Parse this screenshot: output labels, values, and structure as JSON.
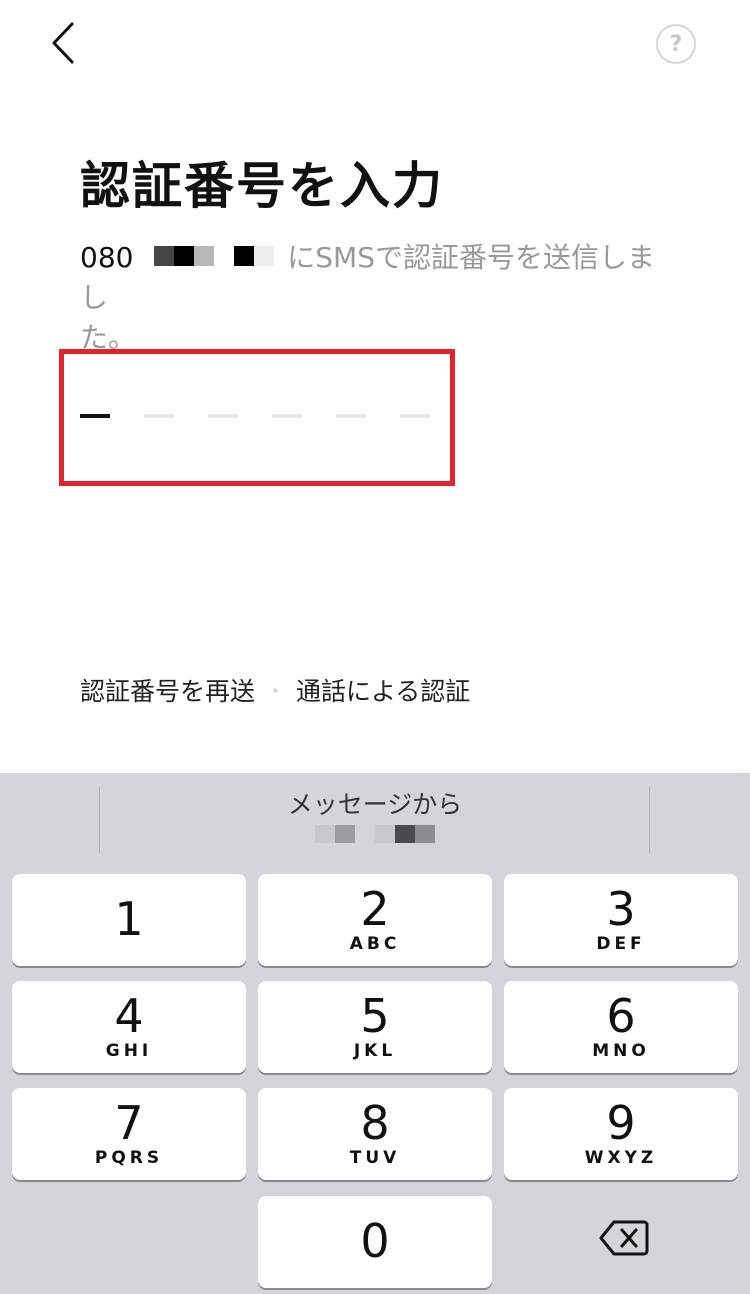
{
  "nav": {
    "back_icon": "chevron-left-icon",
    "help_label": "?"
  },
  "title": "認証番号を入力",
  "subtitle": {
    "phone_prefix": "080",
    "text_line": "にSMSで認証番号を送信しまし",
    "text_line2": "た。"
  },
  "code_input": {
    "length": 6,
    "filled": 0
  },
  "links": {
    "resend": "認証番号を再送",
    "call": "通話による認証"
  },
  "keyboard": {
    "suggestion_label": "メッセージから",
    "keys": [
      {
        "num": "1",
        "letters": ""
      },
      {
        "num": "2",
        "letters": "ABC"
      },
      {
        "num": "3",
        "letters": "DEF"
      },
      {
        "num": "4",
        "letters": "GHI"
      },
      {
        "num": "5",
        "letters": "JKL"
      },
      {
        "num": "6",
        "letters": "MNO"
      },
      {
        "num": "7",
        "letters": "PQRS"
      },
      {
        "num": "8",
        "letters": "TUV"
      },
      {
        "num": "9",
        "letters": "WXYZ"
      },
      {
        "num": "0",
        "letters": ""
      }
    ],
    "delete_icon": "backspace-icon"
  },
  "colors": {
    "highlight": "#e3232c",
    "keyboard_bg": "#d3d5db"
  }
}
